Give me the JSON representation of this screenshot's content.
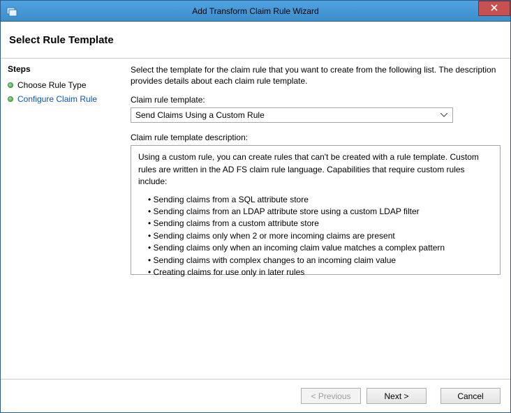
{
  "window": {
    "title": "Add Transform Claim Rule Wizard"
  },
  "header": {
    "title": "Select Rule Template"
  },
  "sidebar": {
    "title": "Steps",
    "items": [
      {
        "label": "Choose Rule Type"
      },
      {
        "label": "Configure Claim Rule"
      }
    ]
  },
  "main": {
    "intro": "Select the template for the claim rule that you want to create from the following list. The description provides details about each claim rule template.",
    "template_label": "Claim rule template:",
    "template_value": "Send Claims Using a Custom Rule",
    "desc_label": "Claim rule template description:",
    "desc_intro": "Using a custom rule, you can create rules that can't be created with a rule template.  Custom rules are written in the AD FS claim rule language.  Capabilities that require custom rules include:",
    "desc_bullets": [
      "Sending claims from a SQL attribute store",
      "Sending claims from an LDAP attribute store using a custom LDAP filter",
      "Sending claims from a custom attribute store",
      "Sending claims only when 2 or more incoming claims are present",
      "Sending claims only when an incoming claim value matches a complex pattern",
      "Sending claims with complex changes to an incoming claim value",
      "Creating claims for use only in later rules"
    ]
  },
  "footer": {
    "previous": "< Previous",
    "next": "Next >",
    "cancel": "Cancel"
  }
}
